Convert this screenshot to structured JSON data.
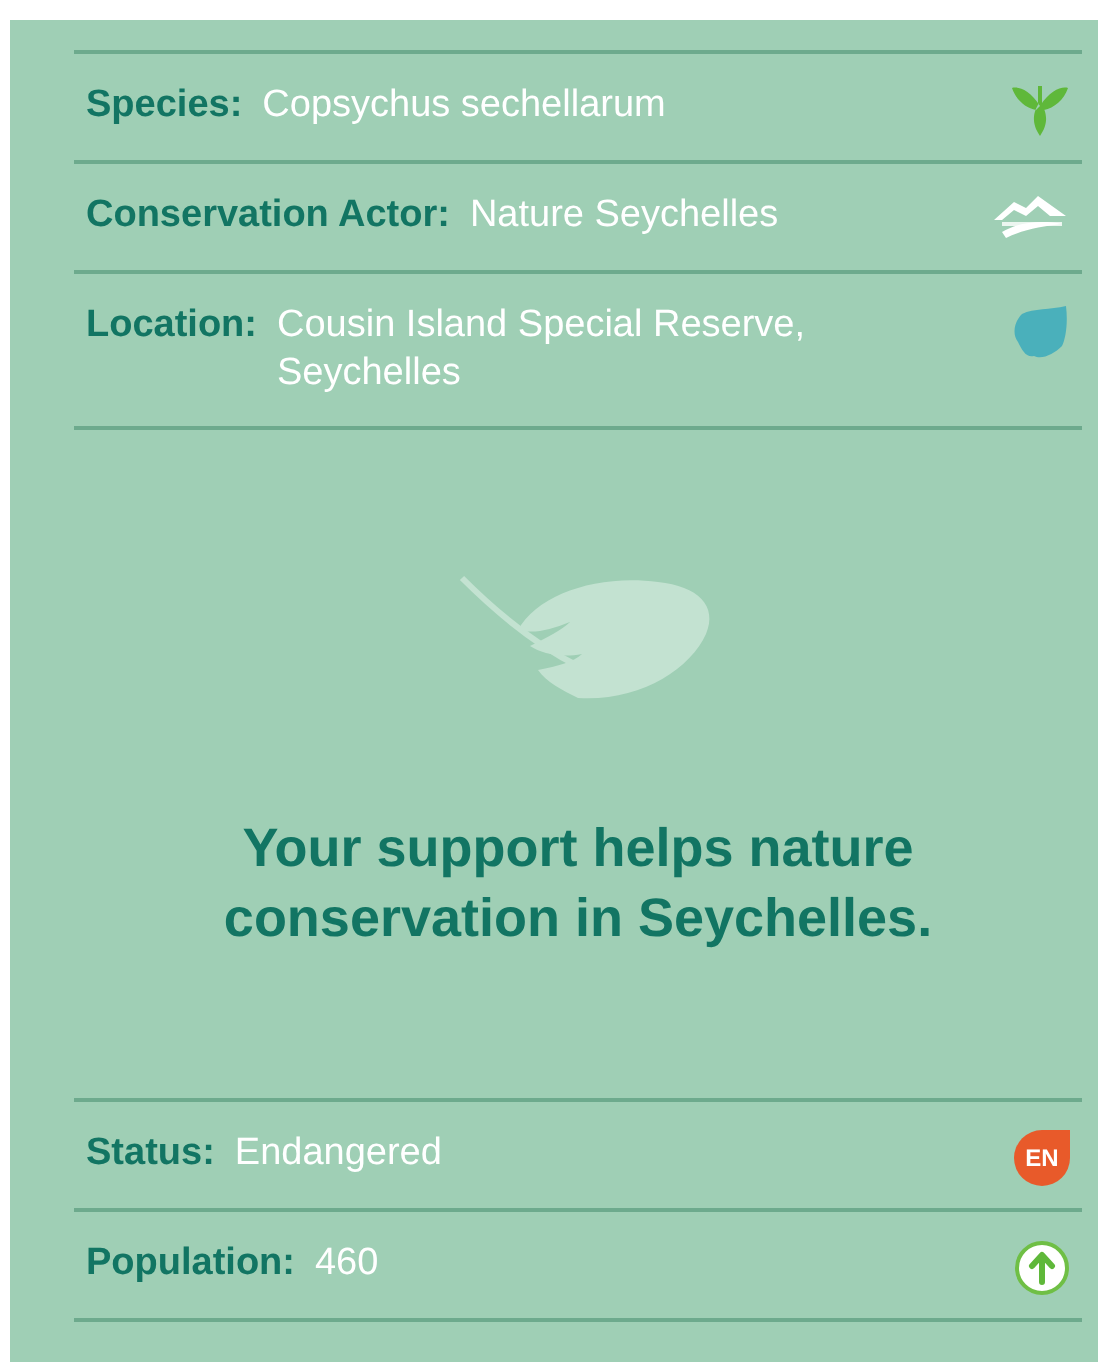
{
  "top_rows": [
    {
      "label": "Species:",
      "value": "Copsychus sechellarum",
      "kind": "plant"
    },
    {
      "label": "Conservation Actor:",
      "value": "Nature Seychelles",
      "kind": "logo"
    },
    {
      "label": "Location:",
      "value": "Cousin Island Special Reserve, Seychelles",
      "kind": "island"
    }
  ],
  "message": "Your support helps nature conservation in Seychelles.",
  "bottom_rows": [
    {
      "label": "Status:",
      "value": "Endangered",
      "kind": "badge",
      "badge": "EN"
    },
    {
      "label": "Population:",
      "value": "460",
      "kind": "arrow"
    }
  ]
}
